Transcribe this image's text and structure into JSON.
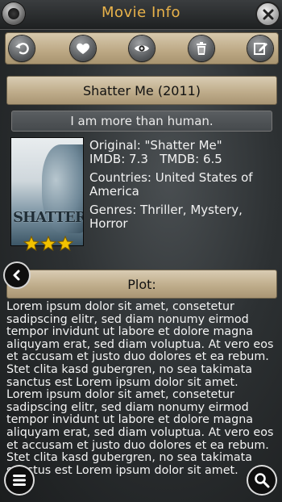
{
  "header": {
    "title": "Movie Info"
  },
  "toolbar": {
    "buttons": [
      "back-icon",
      "heart-icon",
      "eye-icon",
      "trash-icon",
      "edit-icon"
    ]
  },
  "movie": {
    "title": "Shatter Me (2011)",
    "tagline": "I am more than human.",
    "poster_text": "SHATTER",
    "rating_stars": 3,
    "original": "Original: \"Shatter Me\"",
    "scores": "IMDB: 7.3   TMDB: 6.5",
    "countries": "Countries: United States of America",
    "genres": "Genres: Thriller, Mystery, Horror"
  },
  "plot": {
    "label": "Plot:",
    "text": "Lorem ipsum dolor sit amet, consetetur sadipscing elitr, sed diam nonumy eirmod tempor invidunt ut labore et dolore magna aliquyam erat, sed diam voluptua. At vero eos et accusam et justo duo dolores et ea rebum. Stet clita kasd gubergren, no sea takimata sanctus est Lorem ipsum dolor sit amet. Lorem ipsum dolor sit amet, consetetur sadipscing elitr, sed diam nonumy eirmod tempor invidunt ut labore et dolore magna aliquyam erat, sed diam voluptua. At vero eos et accusam et justo duo dolores et ea rebum. Stet clita kasd gubergren, no sea takimata sanctus est Lorem ipsum dolor sit amet."
  },
  "colors": {
    "title_accent": "#e8b24a",
    "band": "#bfad8b",
    "star": "#f2c200"
  }
}
